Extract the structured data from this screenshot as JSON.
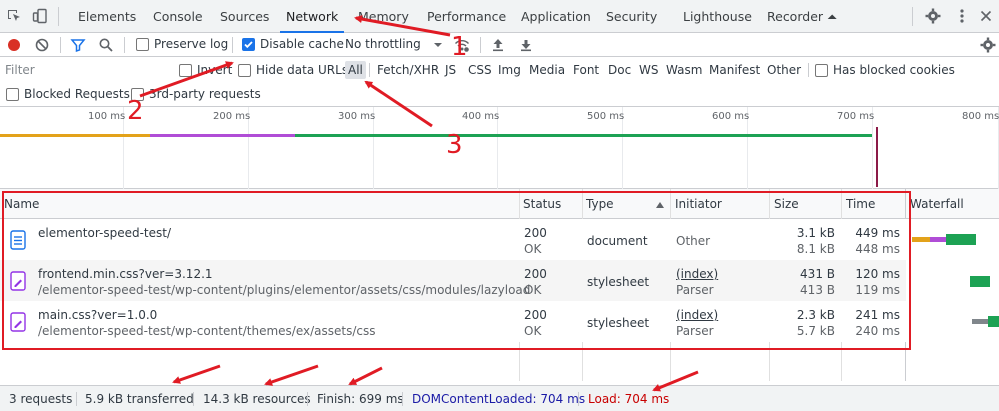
{
  "tabs": [
    {
      "label": "Elements"
    },
    {
      "label": "Console"
    },
    {
      "label": "Sources"
    },
    {
      "label": "Network"
    },
    {
      "label": "Memory"
    },
    {
      "label": "Performance"
    },
    {
      "label": "Application"
    },
    {
      "label": "Security"
    },
    {
      "label": "Lighthouse"
    },
    {
      "label": "Recorder ⏶"
    }
  ],
  "toolbar": {
    "preserve_log": "Preserve log",
    "disable_cache": "Disable cache",
    "throttling": "No throttling"
  },
  "filter": {
    "placeholder": "Filter",
    "invert": "Invert",
    "hide_data_urls": "Hide data URLs",
    "types": [
      "All",
      "Fetch/XHR",
      "JS",
      "CSS",
      "Img",
      "Media",
      "Font",
      "Doc",
      "WS",
      "Wasm",
      "Manifest",
      "Other"
    ],
    "has_blocked_cookies": "Has blocked cookies",
    "blocked_requests": "Blocked Requests",
    "third_party": "3rd-party requests"
  },
  "overview": {
    "ticks": [
      "100 ms",
      "200 ms",
      "300 ms",
      "400 ms",
      "500 ms",
      "600 ms",
      "700 ms",
      "800 ms"
    ]
  },
  "table": {
    "headers": {
      "name": "Name",
      "status": "Status",
      "type": "Type",
      "initiator": "Initiator",
      "size": "Size",
      "time": "Time",
      "waterfall": "Waterfall"
    },
    "rows": [
      {
        "name": "elementor-speed-test/",
        "path": "",
        "status": "200",
        "status_text": "OK",
        "type": "document",
        "initiator": "Other",
        "initiator_sub": "",
        "size1": "3.1 kB",
        "size2": "8.1 kB",
        "time1": "449 ms",
        "time2": "448 ms"
      },
      {
        "name": "frontend.min.css?ver=3.12.1",
        "path": "/elementor-speed-test/wp-content/plugins/elementor/assets/css/modules/lazyload",
        "status": "200",
        "status_text": "OK",
        "type": "stylesheet",
        "initiator": "(index)",
        "initiator_sub": "Parser",
        "size1": "431 B",
        "size2": "413 B",
        "time1": "120 ms",
        "time2": "119 ms"
      },
      {
        "name": "main.css?ver=1.0.0",
        "path": "/elementor-speed-test/wp-content/themes/ex/assets/css",
        "status": "200",
        "status_text": "OK",
        "type": "stylesheet",
        "initiator": "(index)",
        "initiator_sub": "Parser",
        "size1": "2.3 kB",
        "size2": "5.7 kB",
        "time1": "241 ms",
        "time2": "240 ms"
      }
    ]
  },
  "status": {
    "requests": "3 requests",
    "transferred": "5.9 kB transferred",
    "resources": "14.3 kB resources",
    "finish": "Finish: 699 ms",
    "dcl": "DOMContentLoaded: 704 ms",
    "load": "Load: 704 ms"
  },
  "annotations": {
    "n1": "1",
    "n2": "2",
    "n3": "3"
  },
  "colors": {
    "accent": "#1a73e8",
    "annotation": "#e01b24",
    "dcl": "#1a1aa6",
    "load": "#c80000"
  }
}
